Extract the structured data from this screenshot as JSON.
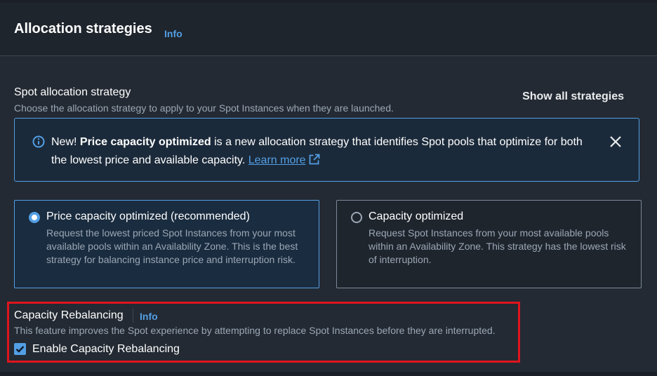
{
  "header": {
    "title": "Allocation strategies",
    "info": "Info"
  },
  "spot": {
    "label": "Spot allocation strategy",
    "description": "Choose the allocation strategy to apply to your Spot Instances when they are launched.",
    "show_all": "Show all strategies"
  },
  "alert": {
    "prefix": "New! ",
    "bold": "Price capacity optimized",
    "text": " is a new allocation strategy that identifies Spot pools that optimize for both the lowest price and available capacity. ",
    "learn_more": "Learn more"
  },
  "tiles": [
    {
      "title": "Price capacity optimized (recommended)",
      "description": "Request the lowest priced Spot Instances from your most available pools within an Availability Zone. This is the best strategy for balancing instance price and interruption risk.",
      "selected": true
    },
    {
      "title": "Capacity optimized",
      "description": "Request Spot Instances from your most available pools within an Availability Zone. This strategy has the lowest risk of interruption.",
      "selected": false
    }
  ],
  "rebalancing": {
    "label": "Capacity Rebalancing",
    "info": "Info",
    "description": "This feature improves the Spot experience by attempting to replace Spot Instances before they are interrupted.",
    "checkbox_label": "Enable Capacity Rebalancing",
    "checked": true
  },
  "colors": {
    "accent": "#539fe5",
    "highlight": "#e0141e",
    "panel": "#232a33"
  }
}
